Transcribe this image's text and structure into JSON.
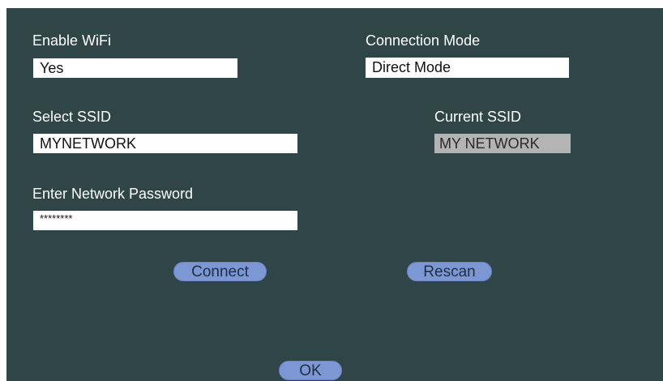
{
  "wifi": {
    "enable_label": "Enable WiFi",
    "enable_value": "Yes",
    "mode_label": "Connection Mode",
    "mode_value": "Direct Mode",
    "select_ssid_label": "Select SSID",
    "select_ssid_value": "MYNETWORK",
    "current_ssid_label": "Current SSID",
    "current_ssid_value": "MY NETWORK",
    "password_label": "Enter Network Password",
    "password_value": "********"
  },
  "buttons": {
    "connect": "Connect",
    "rescan": "Rescan",
    "ok": "OK"
  },
  "colors": {
    "panel_background": "#2f4548",
    "button_fill": "#7c97d3",
    "readonly_field": "#b4b4b4"
  }
}
